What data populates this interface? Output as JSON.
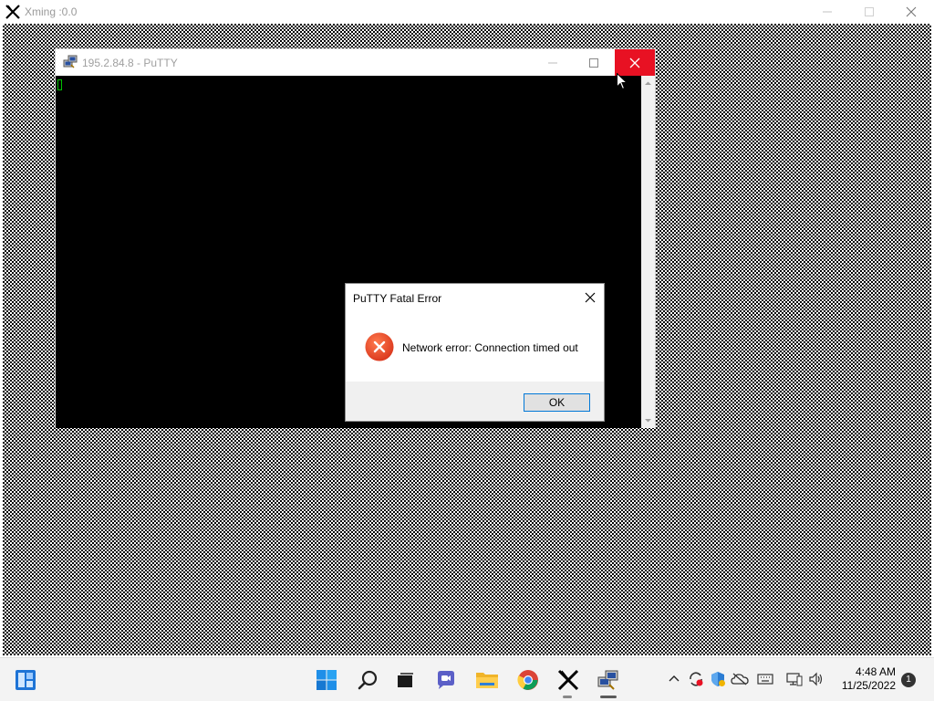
{
  "xming": {
    "title": "Xming :0.0"
  },
  "putty": {
    "title": "195.2.84.8 - PuTTY"
  },
  "dialog": {
    "title": "PuTTY Fatal Error",
    "message": "Network error: Connection timed out",
    "ok_label": "OK",
    "icon": "error-icon"
  },
  "taskbar": {
    "apps": [
      "widgets-icon",
      "start-icon",
      "search-icon",
      "task-view-icon",
      "chat-icon",
      "file-explorer-icon",
      "chrome-icon",
      "xming-icon",
      "putty-icon"
    ],
    "tray": [
      "show-hidden-icons-icon",
      "sync-icon",
      "security-icon",
      "onedrive-icon",
      "keyboard-icon",
      "network-icon",
      "volume-icon"
    ],
    "time": "4:48 AM",
    "date": "11/25/2022",
    "notification_count": "1"
  },
  "colors": {
    "close_red": "#e81123",
    "accent_blue": "#0078d7",
    "terminal_bg": "#000000",
    "cursor_green": "#00c000"
  }
}
